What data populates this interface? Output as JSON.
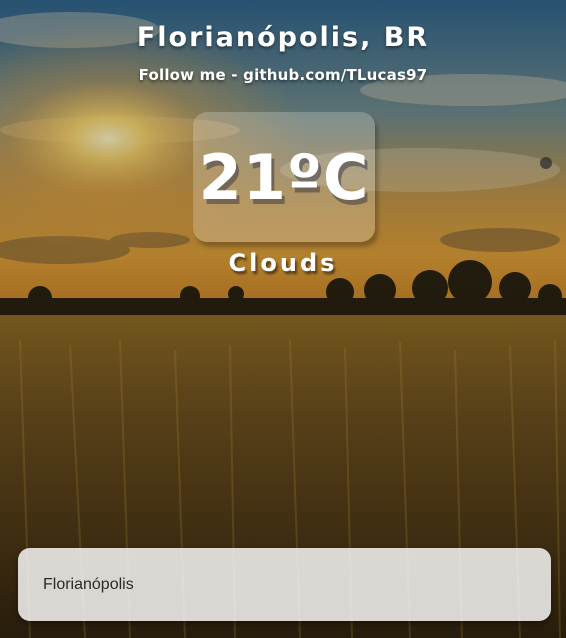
{
  "weather": {
    "location": "Florianópolis, BR",
    "follow_text": "Follow me - github.com/TLucas97",
    "temperature": "21ºC",
    "condition": "Clouds"
  },
  "search": {
    "value": "Florianópolis"
  },
  "background": {
    "icon": "sunset-wheat-field-image"
  }
}
